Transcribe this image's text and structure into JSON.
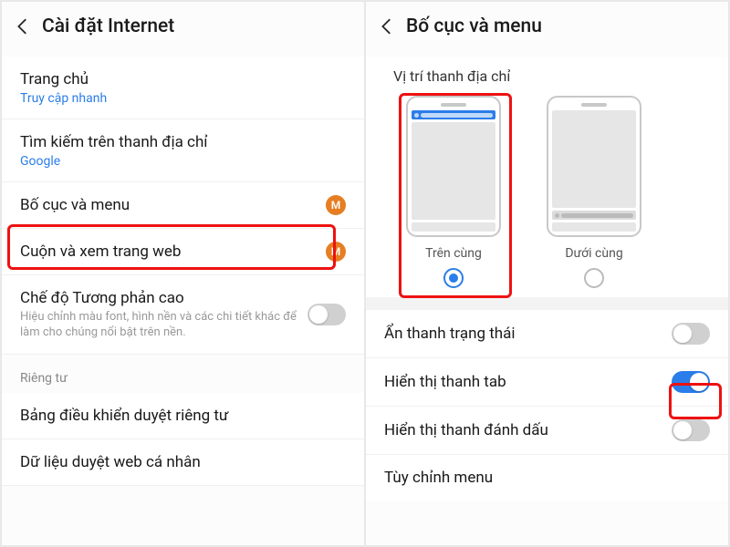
{
  "left": {
    "title": "Cài đặt Internet",
    "items": {
      "home": {
        "title": "Trang chủ",
        "sub": "Truy cập nhanh"
      },
      "search": {
        "title": "Tìm kiếm trên thanh địa chỉ",
        "sub": "Google"
      },
      "layout": {
        "title": "Bố cục và menu"
      },
      "scroll": {
        "title": "Cuộn và xem trang web"
      },
      "contrast": {
        "title": "Chế độ Tương phản cao",
        "desc": "Hiệu chỉnh màu font, hình nền và các chi tiết khác để làm cho chúng nổi bật trên nền."
      },
      "privacyHeader": "Riêng tư",
      "privacyDash": {
        "title": "Bảng điều khiển duyệt riêng tư"
      },
      "personalData": {
        "title": "Dữ liệu duyệt web cá nhân"
      }
    },
    "badge": "M"
  },
  "right": {
    "title": "Bố cục và menu",
    "addrTitle": "Vị trí thanh địa chỉ",
    "optTop": "Trên cùng",
    "optBottom": "Dưới cùng",
    "items": {
      "hideStatus": {
        "title": "Ẩn thanh trạng thái"
      },
      "showTab": {
        "title": "Hiển thị thanh tab"
      },
      "showBookmark": {
        "title": "Hiển thị thanh đánh dấu"
      },
      "customMenu": {
        "title": "Tùy chỉnh menu"
      }
    }
  }
}
